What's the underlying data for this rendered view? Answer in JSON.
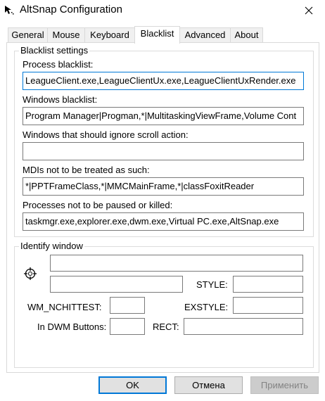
{
  "window": {
    "title": "AltSnap Configuration",
    "app_icon": "altsnap-cursor-icon",
    "close_icon": "close-icon"
  },
  "tabs": [
    {
      "label": "General"
    },
    {
      "label": "Mouse"
    },
    {
      "label": "Keyboard"
    },
    {
      "label": "Blacklist",
      "active": true
    },
    {
      "label": "Advanced"
    },
    {
      "label": "About"
    }
  ],
  "blacklist_settings": {
    "title": "Blacklist settings",
    "process_blacklist": {
      "label": "Process blacklist:",
      "value": "LeagueClient.exe,LeagueClientUx.exe,LeagueClientUxRender.exe"
    },
    "windows_blacklist": {
      "label": "Windows blacklist:",
      "value": "Program Manager|Progman,*|MultitaskingViewFrame,Volume Cont"
    },
    "scroll_ignore": {
      "label": "Windows that should ignore scroll action:",
      "value": ""
    },
    "mdis": {
      "label": "MDIs not to be treated as such:",
      "value": "*|PPTFrameClass,*|MMCMainFrame,*|classFoxitReader"
    },
    "no_pause": {
      "label": "Processes not to be paused or killed:",
      "value": "taskmgr.exe,explorer.exe,dwm.exe,Virtual PC.exe,AltSnap.exe"
    }
  },
  "identify_window": {
    "title": "Identify window",
    "finder_icon": "crosshair-finder-icon",
    "style_label": "STYLE:",
    "exstyle_label": "EXSTYLE:",
    "nchittest_label": "WM_NCHITTEST:",
    "dwm_buttons_label": "In DWM Buttons:",
    "rect_label": "RECT:"
  },
  "buttons": {
    "ok": "OK",
    "cancel": "Отмена",
    "apply": "Применить"
  },
  "colors": {
    "focus": "#0078d7",
    "border": "#7a7a7a",
    "button_bg": "#e1e1e1"
  }
}
